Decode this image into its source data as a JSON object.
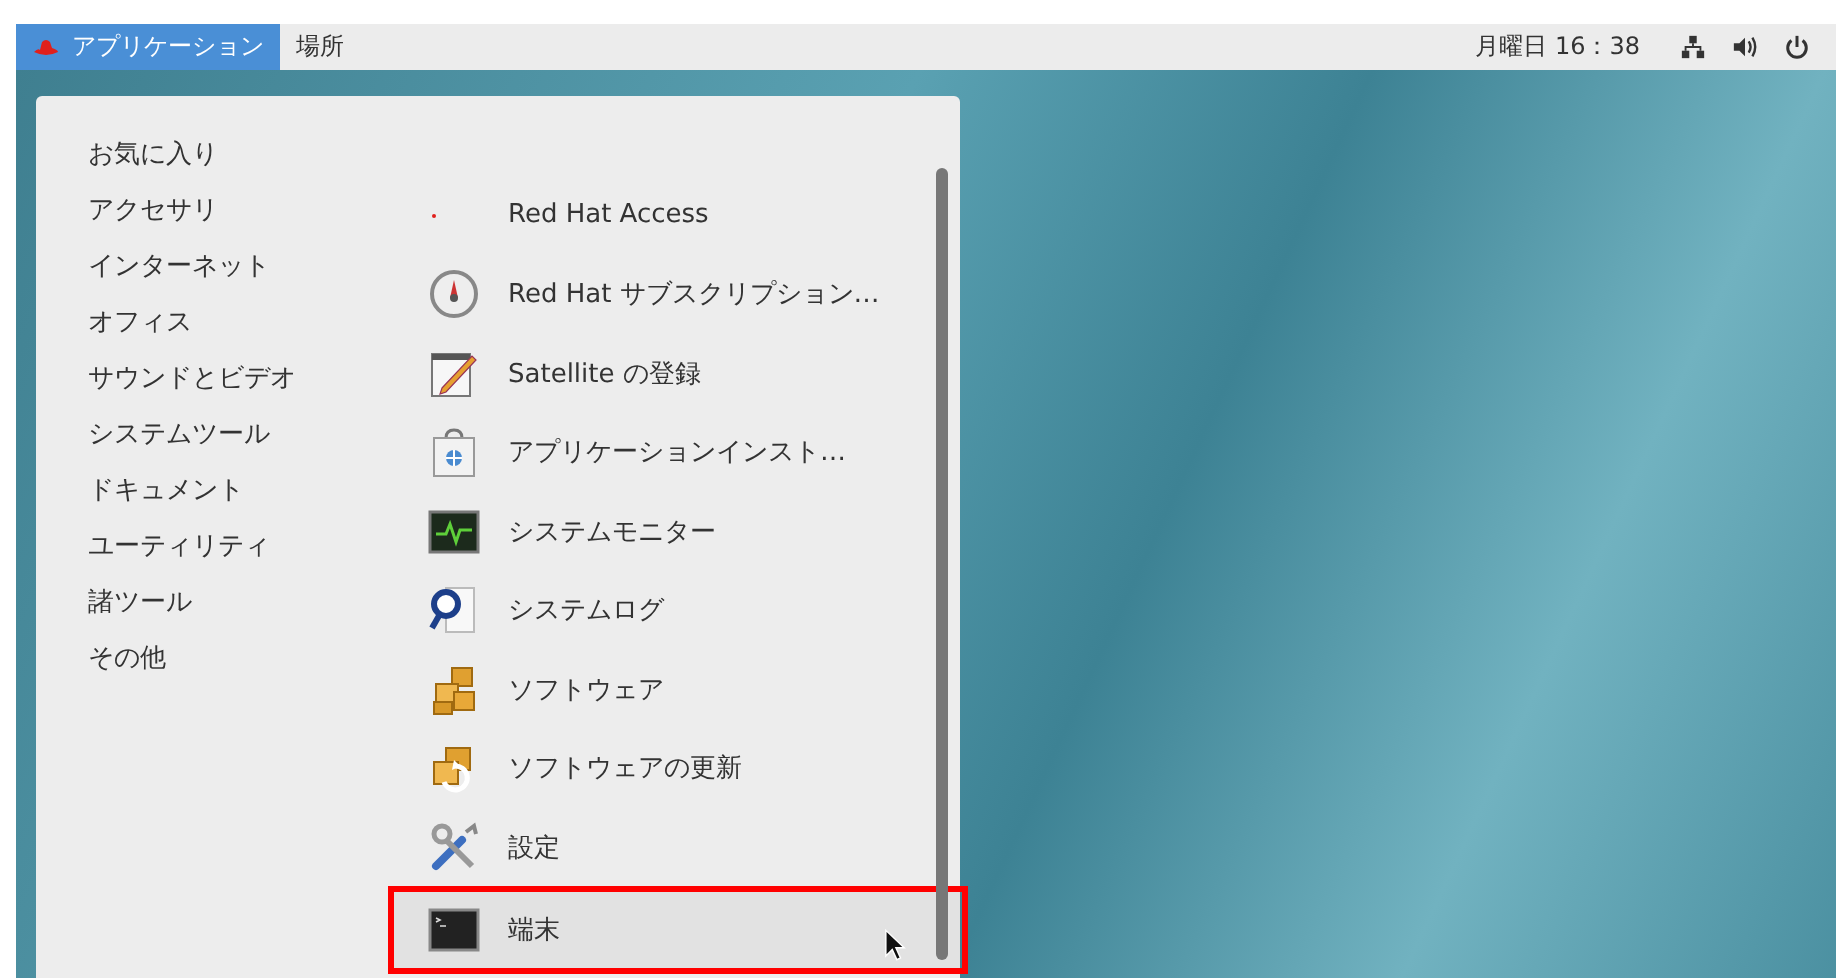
{
  "top_bar": {
    "menus": [
      {
        "label": "アプリケーション",
        "selected": true,
        "kind": "applications"
      },
      {
        "label": "場所",
        "selected": false,
        "kind": "places"
      }
    ],
    "clock": "月曜日 16：38"
  },
  "menu": {
    "categories": [
      "お気に入り",
      "アクセサリ",
      "インターネット",
      "オフィス",
      "サウンドとビデオ",
      "システムツール",
      "ドキュメント",
      "ユーティリティ",
      "諸ツール",
      "その他"
    ],
    "apps": [
      {
        "label": "Red Hat Access",
        "kind": "redhat",
        "hovered": false
      },
      {
        "label": "Red Hat サブスクリプション…",
        "kind": "gauge",
        "hovered": false
      },
      {
        "label": "Satellite の登録",
        "kind": "notepad",
        "hovered": false
      },
      {
        "label": "アプリケーションインスト…",
        "kind": "bag",
        "hovered": false
      },
      {
        "label": "システムモニター",
        "kind": "monitor",
        "hovered": false
      },
      {
        "label": "システムログ",
        "kind": "log",
        "hovered": false
      },
      {
        "label": "ソフトウェア",
        "kind": "boxes",
        "hovered": false
      },
      {
        "label": "ソフトウェアの更新",
        "kind": "update",
        "hovered": false
      },
      {
        "label": "設定",
        "kind": "tools",
        "hovered": false
      },
      {
        "label": "端末",
        "kind": "terminal",
        "hovered": true
      }
    ]
  }
}
